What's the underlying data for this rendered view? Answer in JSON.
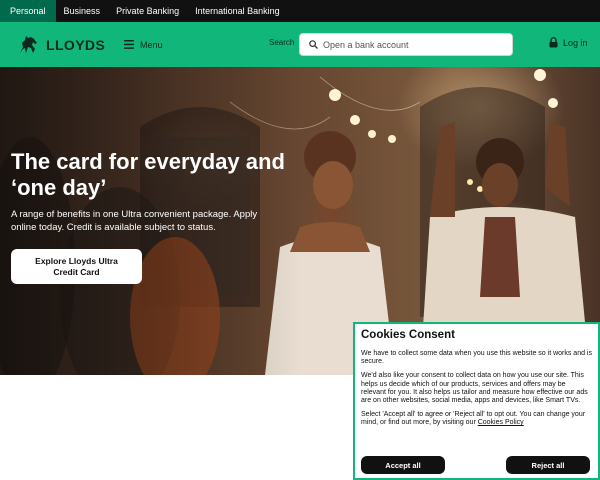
{
  "topnav": {
    "segments": [
      {
        "label": "Personal",
        "active": true
      },
      {
        "label": "Business",
        "active": false
      },
      {
        "label": "Private Banking",
        "active": false
      },
      {
        "label": "International Banking",
        "active": false
      }
    ]
  },
  "header": {
    "logo_text": "LLOYDS",
    "menu_label": "Menu",
    "search_label": "Search",
    "search_placeholder": "Open a bank account",
    "login_label": "Log in"
  },
  "hero": {
    "title": "The card for everyday and ‘one day’",
    "subtitle": "A range of benefits in one Ultra convenient package. Apply online today. Credit is available subject to status.",
    "cta_label": "Explore Lloyds Ultra Credit Card"
  },
  "cookies": {
    "title": "Cookies Consent",
    "paragraph1": "We have to collect some data when you use this website so it works and is secure.",
    "paragraph2": "We'd also like your consent to collect data on how you use our site. This helps us decide which of our products, services and offers may be relevant for you. It also helps us tailor and measure how effective our ads are on other websites, social media, apps and devices, like Smart TVs.",
    "paragraph3_prefix": "Select 'Accept all' to agree or 'Reject all' to opt out. You can change your mind, or find out more, by visiting our ",
    "policy_link": "Cookies Policy",
    "accept_label": "Accept all",
    "reject_label": "Reject all"
  },
  "colors": {
    "brand_green": "#11b67a",
    "dark_green": "#006a4d",
    "topbar": "#111111"
  },
  "icons": [
    "horse-logo-icon",
    "menu-icon",
    "search-icon",
    "padlock-icon"
  ]
}
